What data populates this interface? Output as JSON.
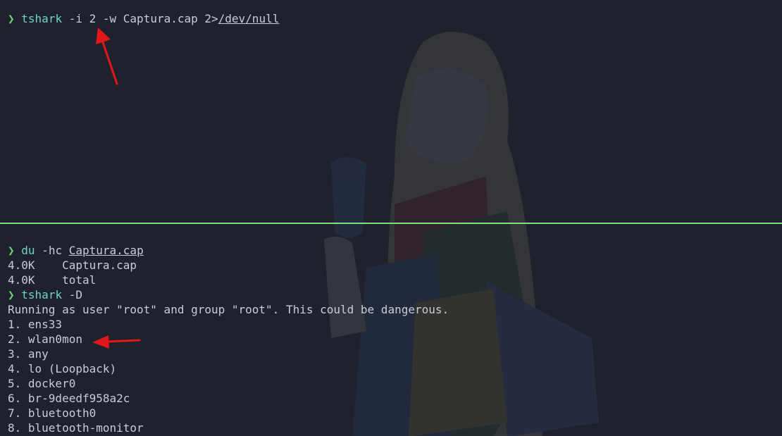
{
  "top_pane": {
    "prompt": "❯",
    "command": "tshark",
    "args": "-i 2 -w Captura.cap 2>",
    "redirect_target": "/dev/null"
  },
  "bottom_pane": {
    "prompt": "❯",
    "du_command": "du",
    "du_args": "-hc",
    "du_file": "Captura.cap",
    "du_output": [
      "4.0K    Captura.cap",
      "4.0K    total"
    ],
    "tshark_command": "tshark",
    "tshark_args": "-D",
    "warning": "Running as user \"root\" and group \"root\". This could be dangerous.",
    "interfaces": [
      "1. ens33",
      "2. wlan0mon",
      "3. any",
      "4. lo (Loopback)",
      "5. docker0",
      "6. br-9deedf958a2c",
      "7. bluetooth0",
      "8. bluetooth-monitor"
    ]
  },
  "colors": {
    "background": "#1f222d",
    "prompt": "#69d86d",
    "command": "#6fd5c2",
    "divider": "#7ee07a",
    "annotation_arrow": "#e01818"
  }
}
